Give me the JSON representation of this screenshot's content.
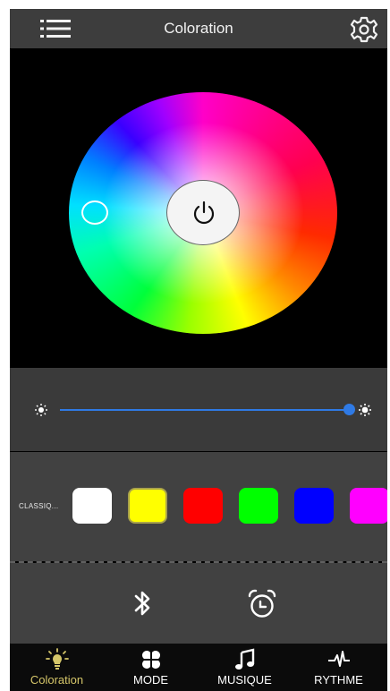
{
  "header": {
    "title": "Coloration",
    "menu_icon": "hamburger-menu-icon",
    "settings_icon": "gear-icon"
  },
  "wheel": {
    "power_icon": "power-icon"
  },
  "brightness": {
    "level_percent": 100,
    "min_icon": "sun-small-icon",
    "max_icon": "sun-large-icon",
    "accent_color": "#2f7ae5"
  },
  "palette": {
    "label": "CLASSIQ...",
    "swatches": [
      {
        "color": "#ffffff",
        "selected": false
      },
      {
        "color": "#ffff00",
        "selected": true
      },
      {
        "color": "#ff0000",
        "selected": false
      },
      {
        "color": "#00ff00",
        "selected": false
      },
      {
        "color": "#0000ff",
        "selected": false
      },
      {
        "color": "#ff00ff",
        "selected": false
      }
    ]
  },
  "tools": {
    "bluetooth_icon": "bluetooth-icon",
    "timer_icon": "alarm-clock-icon"
  },
  "tabs": [
    {
      "label": "Coloration",
      "icon": "lightbulb-icon",
      "active": true
    },
    {
      "label": "MODE",
      "icon": "clover-icon",
      "active": false
    },
    {
      "label": "MUSIQUE",
      "icon": "music-note-icon",
      "active": false
    },
    {
      "label": "RYTHME",
      "icon": "heartbeat-icon",
      "active": false
    }
  ]
}
